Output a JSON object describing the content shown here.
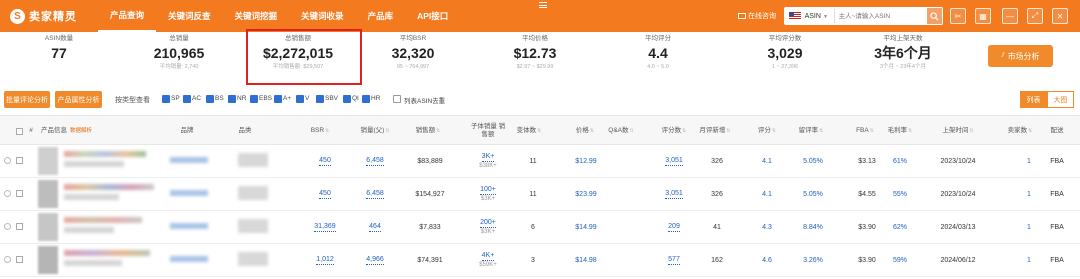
{
  "app": {
    "logo_text": "卖家精灵",
    "nav": [
      "产品查询",
      "关键词反查",
      "关键词挖掘",
      "关键词收录",
      "产品库",
      "API接口"
    ],
    "online_help": "在线咨询",
    "search": {
      "type": "ASIN",
      "placeholder": "主人~请输入ASIN"
    }
  },
  "stats": [
    {
      "label": "ASIN数量",
      "value": "77",
      "sub": ""
    },
    {
      "label": "总销量",
      "value": "210,965",
      "sub": "平均销量: 2,740"
    },
    {
      "label": "总销售额",
      "value": "$2,272,015",
      "sub": "平均销售额: $29,507"
    },
    {
      "label": "平均BSR",
      "value": "32,320",
      "sub": "95 ~ 764,997"
    },
    {
      "label": "平均价格",
      "value": "$12.73",
      "sub": "$2.97 ~ $29.99"
    },
    {
      "label": "平均评分",
      "value": "4.4",
      "sub": "4.0 ~ 5.0"
    },
    {
      "label": "平均评分数",
      "value": "3,029",
      "sub": "1 ~ 27,396"
    },
    {
      "label": "平均上架天数",
      "value": "3年6个月",
      "sub": "3个月 ~ 23年4个月"
    }
  ],
  "market_button": "市场分析",
  "filters": {
    "batch_review": "批量评论分析",
    "attr_analysis": "产品属性分析",
    "type_label": "按类型查看",
    "types": [
      "SP",
      "AC",
      "BS",
      "NR",
      "EBS",
      "A+",
      "V",
      "SBV",
      "QI",
      "HR"
    ],
    "variant_label": "列表ASIN去重",
    "views": [
      "列表",
      "大图"
    ]
  },
  "columns": [
    "#",
    "产品信息",
    "品牌",
    "品类",
    "BSR",
    "销量(父)",
    "销售额",
    "子体销量 销售额",
    "变体数",
    "价格",
    "Q&A数",
    "评分数",
    "月评新增",
    "评分",
    "留评率",
    "FBA",
    "毛利率",
    "上架时间",
    "卖家数",
    "配送"
  ],
  "column_tag": "数据解析",
  "rows": [
    {
      "bsr": "450",
      "sales": "6,458",
      "revenue": "$83,889",
      "sub_sales": "3K+",
      "sub_rev": "$38K+",
      "variants": "11",
      "price": "$12.99",
      "qa": "",
      "ratings": "3,051",
      "monthly": "326",
      "rating": "4.1",
      "review_rate": "5.05%",
      "fba": "$3.13",
      "margin": "61%",
      "date": "2023/10/24",
      "sellers": "1",
      "ship": "FBA"
    },
    {
      "bsr": "450",
      "sales": "6,458",
      "revenue": "$154,927",
      "sub_sales": "100+",
      "sub_rev": "$3K+",
      "variants": "11",
      "price": "$23.99",
      "qa": "",
      "ratings": "3,051",
      "monthly": "326",
      "rating": "4.1",
      "review_rate": "5.05%",
      "fba": "$4.55",
      "margin": "55%",
      "date": "2023/10/24",
      "sellers": "1",
      "ship": "FBA"
    },
    {
      "bsr": "31,369",
      "sales": "464",
      "revenue": "$7,833",
      "sub_sales": "200+",
      "sub_rev": "$3K+",
      "variants": "6",
      "price": "$14.99",
      "qa": "",
      "ratings": "209",
      "monthly": "41",
      "rating": "4.3",
      "review_rate": "8.84%",
      "fba": "$3.90",
      "margin": "62%",
      "date": "2024/03/13",
      "sellers": "1",
      "ship": "FBA"
    },
    {
      "bsr": "1,012",
      "sales": "4,966",
      "revenue": "$74,391",
      "sub_sales": "4K+",
      "sub_rev": "$59K+",
      "variants": "3",
      "price": "$14.98",
      "qa": "",
      "ratings": "577",
      "monthly": "162",
      "rating": "4.6",
      "review_rate": "3.26%",
      "fba": "$3.90",
      "margin": "59%",
      "date": "2024/06/12",
      "sellers": "1",
      "ship": "FBA"
    }
  ]
}
